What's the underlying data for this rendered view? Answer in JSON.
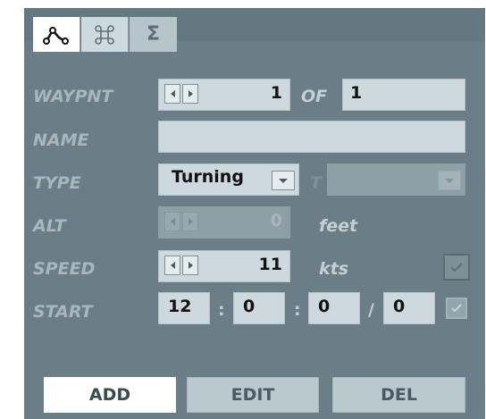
{
  "tabs": [
    {
      "icon": "route-icon"
    },
    {
      "icon": "command-icon"
    },
    {
      "icon": "sigma-icon",
      "glyph": "Σ"
    }
  ],
  "fields": {
    "waypoint": {
      "label": "WAYPNT",
      "value": "1",
      "of_label": "OF",
      "total": "1"
    },
    "name": {
      "label": "NAME",
      "value": ""
    },
    "type": {
      "label": "TYPE",
      "value": "Turning",
      "secondary_label": "T",
      "secondary_value": ""
    },
    "altitude": {
      "label": "ALT",
      "value": "0",
      "unit": "feet"
    },
    "speed": {
      "label": "SPEED",
      "value": "11",
      "unit": "kts"
    },
    "start": {
      "label": "START",
      "hours": "12",
      "minutes": "0",
      "seconds": "0",
      "day": "0",
      "sep_colon": ":",
      "sep_slash": "/"
    }
  },
  "buttons": {
    "add": "ADD",
    "edit": "EDIT",
    "del": "DEL"
  },
  "colors": {
    "panel": "#6b7e87",
    "tab_bar": "#657881",
    "field": "#cdd9dc",
    "label": "#a9b7bc"
  }
}
